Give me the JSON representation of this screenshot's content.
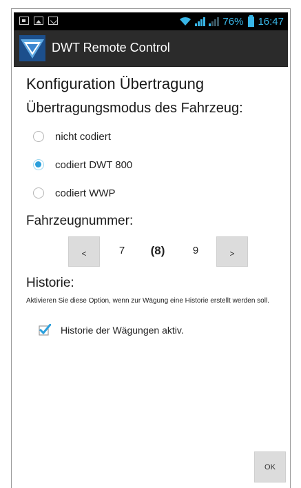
{
  "status_bar": {
    "left_icons": [
      "sim-icon",
      "image-icon",
      "mail-icon"
    ],
    "battery_percent": "76%",
    "time": "16:47",
    "accent_color": "#38b5e6"
  },
  "app_bar": {
    "title": "DWT Remote Control",
    "logo_icon": "dwt-logo-icon"
  },
  "page": {
    "title": "Konfiguration Übertragung",
    "transmission_heading": "Übertragungsmodus des Fahrzeug:",
    "transmission_options": [
      {
        "label": "nicht codiert",
        "selected": false
      },
      {
        "label": "codiert DWT 800",
        "selected": true
      },
      {
        "label": "codiert WWP",
        "selected": false
      }
    ],
    "vehicle_number_heading": "Fahrzeugnummer:",
    "vehicle_stepper": {
      "prev_label": "<",
      "next_label": ">",
      "prev_value": "7",
      "current_value": "(8)",
      "next_value": "9"
    },
    "history_heading": "Historie:",
    "history_description": "Aktivieren Sie diese Option, wenn zur Wägung eine Historie erstellt werden soll.",
    "history_checkbox": {
      "label": "Historie der Wägungen aktiv.",
      "checked": true
    },
    "ok_label": "OK"
  }
}
